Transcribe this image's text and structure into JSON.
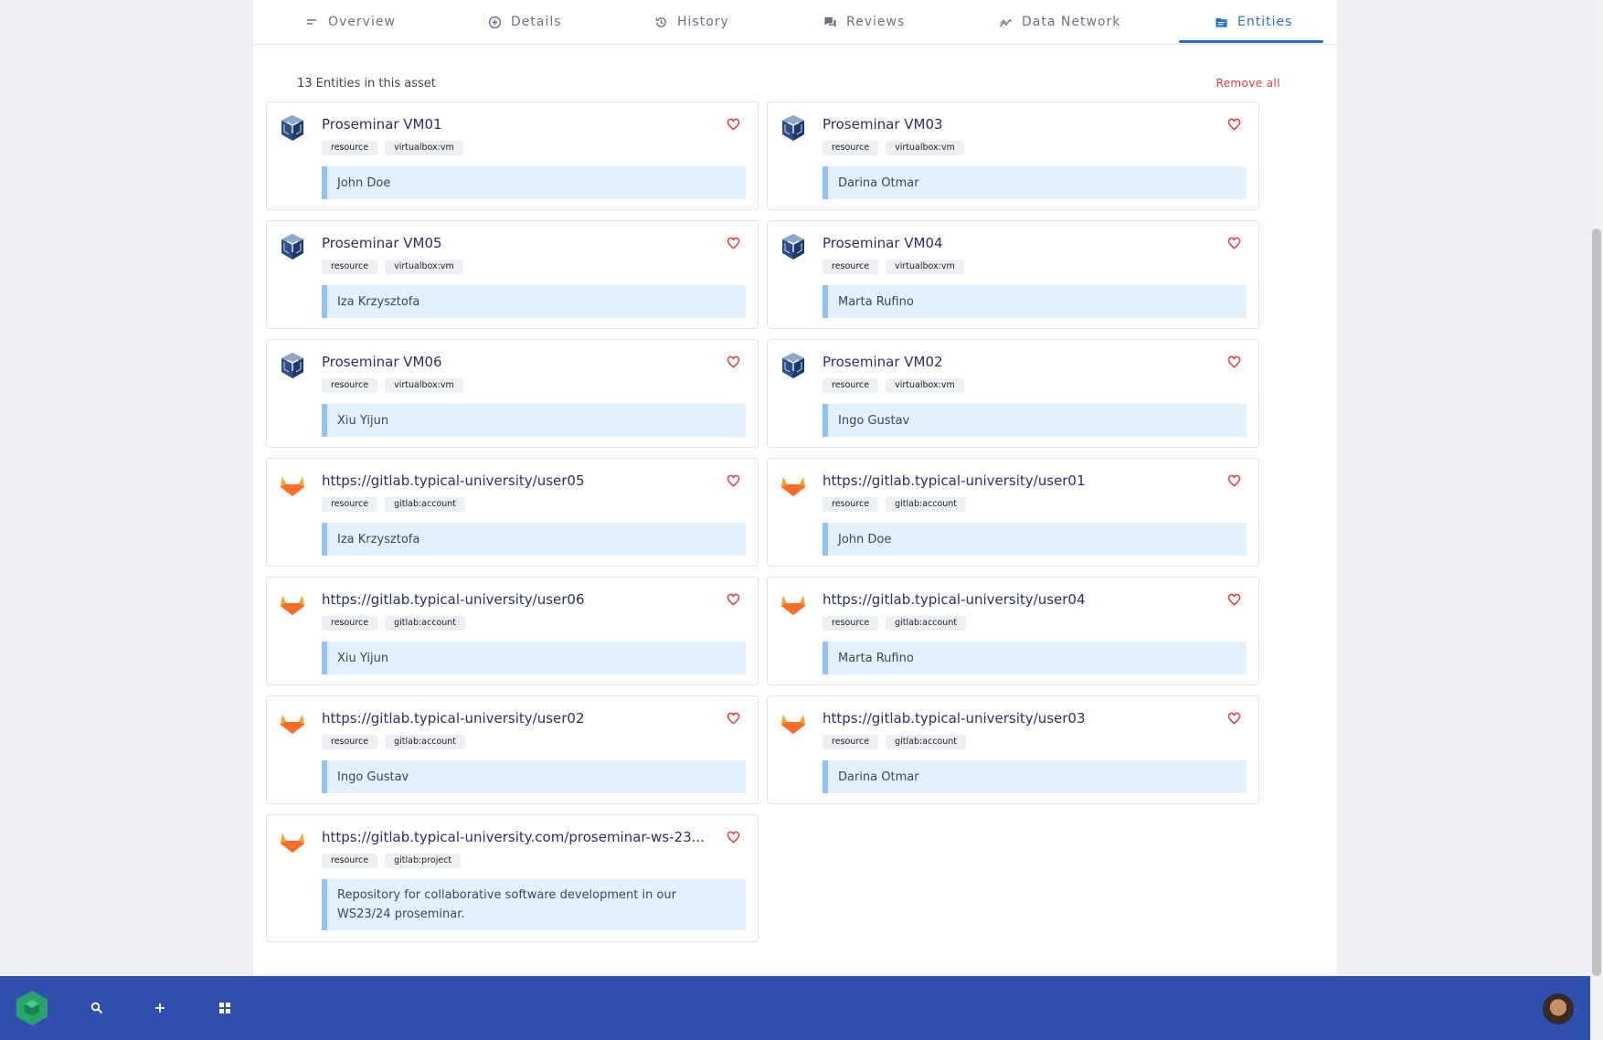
{
  "tabs": [
    {
      "label": "Overview",
      "icon": "short-text-icon"
    },
    {
      "label": "Details",
      "icon": "plus-circle-icon"
    },
    {
      "label": "History",
      "icon": "history-icon"
    },
    {
      "label": "Reviews",
      "icon": "reviews-icon"
    },
    {
      "label": "Data Network",
      "icon": "line-chart-icon"
    },
    {
      "label": "Entities",
      "icon": "folder-icon",
      "active": true
    }
  ],
  "entities": {
    "count_label": "13 Entities in this asset",
    "remove_all": "Remove all",
    "items": [
      {
        "title": "Proseminar VM01",
        "tags": [
          "resource",
          "virtualbox:vm"
        ],
        "owner": "John Doe",
        "icon": "virtualbox-icon"
      },
      {
        "title": "Proseminar VM03",
        "tags": [
          "resource",
          "virtualbox:vm"
        ],
        "owner": "Darina Otmar",
        "icon": "virtualbox-icon"
      },
      {
        "title": "Proseminar VM05",
        "tags": [
          "resource",
          "virtualbox:vm"
        ],
        "owner": "Iza Krzysztofa",
        "icon": "virtualbox-icon"
      },
      {
        "title": "Proseminar VM04",
        "tags": [
          "resource",
          "virtualbox:vm"
        ],
        "owner": "Marta Rufino",
        "icon": "virtualbox-icon"
      },
      {
        "title": "Proseminar VM06",
        "tags": [
          "resource",
          "virtualbox:vm"
        ],
        "owner": "Xiu Yijun",
        "icon": "virtualbox-icon"
      },
      {
        "title": "Proseminar VM02",
        "tags": [
          "resource",
          "virtualbox:vm"
        ],
        "owner": "Ingo Gustav",
        "icon": "virtualbox-icon"
      },
      {
        "title": "https://gitlab.typical-university/user05",
        "tags": [
          "resource",
          "gitlab:account"
        ],
        "owner": "Iza Krzysztofa",
        "icon": "gitlab-icon"
      },
      {
        "title": "https://gitlab.typical-university/user01",
        "tags": [
          "resource",
          "gitlab:account"
        ],
        "owner": "John Doe",
        "icon": "gitlab-icon"
      },
      {
        "title": "https://gitlab.typical-university/user06",
        "tags": [
          "resource",
          "gitlab:account"
        ],
        "owner": "Xiu Yijun",
        "icon": "gitlab-icon"
      },
      {
        "title": "https://gitlab.typical-university/user04",
        "tags": [
          "resource",
          "gitlab:account"
        ],
        "owner": "Marta Rufino",
        "icon": "gitlab-icon"
      },
      {
        "title": "https://gitlab.typical-university/user02",
        "tags": [
          "resource",
          "gitlab:account"
        ],
        "owner": "Ingo Gustav",
        "icon": "gitlab-icon"
      },
      {
        "title": "https://gitlab.typical-university/user03",
        "tags": [
          "resource",
          "gitlab:account"
        ],
        "owner": "Darina Otmar",
        "icon": "gitlab-icon"
      },
      {
        "title": "https://gitlab.typical-university.com/proseminar-ws-23...",
        "tags": [
          "resource",
          "gitlab:project"
        ],
        "owner": "Repository for collaborative software development in our WS23/24 proseminar.",
        "icon": "gitlab-icon"
      }
    ]
  },
  "bottom_bar": {
    "logo": "app-logo-icon",
    "buttons": [
      "search-icon",
      "plus-icon",
      "apps-grid-icon"
    ],
    "avatar": "user-avatar"
  },
  "colors": {
    "accent": "#1f6fd4",
    "bottom_bar": "#3150ad",
    "heart": "#e23b3b",
    "owner_bg": "#e3f0fd",
    "owner_border": "#90c3f3"
  }
}
